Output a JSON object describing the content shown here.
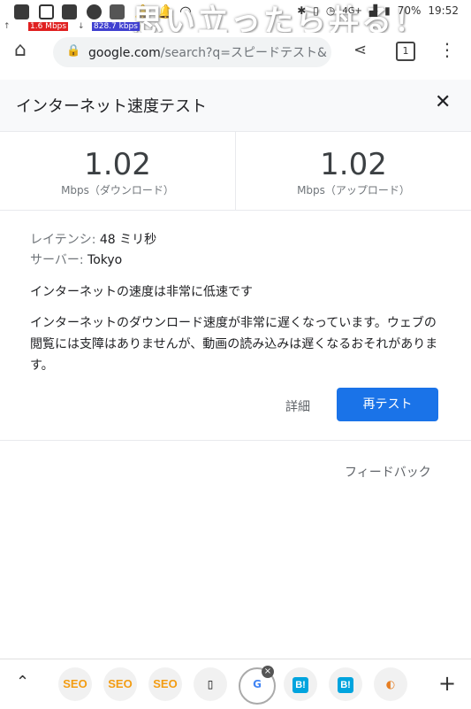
{
  "status_bar": {
    "battery": "70%",
    "time": "19:52",
    "network": "4G+",
    "upload_rate": "1.6 Mbps",
    "download_rate": "828.7 kbps",
    "watermark": "思い立ったら丼る！"
  },
  "browser": {
    "url_domain": "google.com",
    "url_path": "/search?q=スピードテスト&",
    "tab_count": "1"
  },
  "card": {
    "title": "インターネット速度テスト",
    "download": {
      "value": "1.02",
      "label": "Mbps（ダウンロード）"
    },
    "upload": {
      "value": "1.02",
      "label": "Mbps（アップロード）"
    },
    "latency_label": "レイテンシ:",
    "latency_value": "48 ミリ秒",
    "server_label": "サーバー:",
    "server_value": "Tokyo",
    "summary": "インターネットの速度は非常に低速です",
    "description": "インターネットのダウンロード速度が非常に遅くなっています。ウェブの閲覧には支障はありませんが、動画の読み込みは遅くなるおそれがあります。",
    "details_label": "詳細",
    "retest_label": "再テスト",
    "feedback_label": "フィードバック"
  },
  "bottom_tabs": [
    "SEO",
    "SEO",
    "SEO",
    "B!",
    "B!"
  ]
}
